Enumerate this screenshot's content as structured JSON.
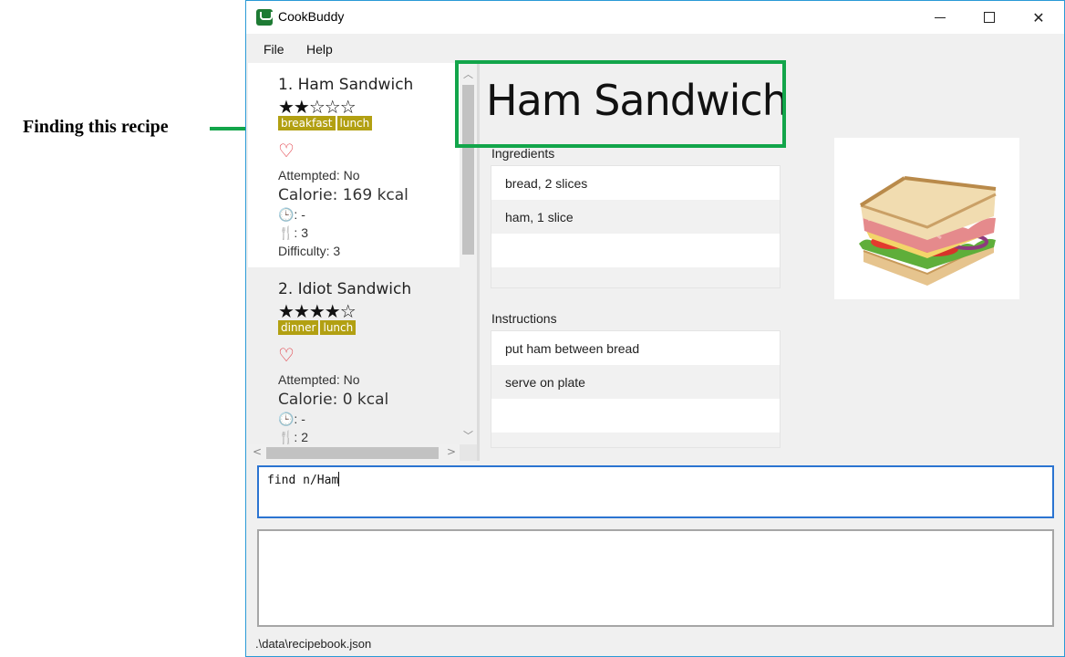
{
  "annotation": {
    "label": "Finding this recipe",
    "color": "#12a54a"
  },
  "window": {
    "title": "CookBuddy",
    "app_icon": "chef-hat-icon",
    "controls": {
      "minimize": "minimize-icon",
      "maximize": "maximize-icon",
      "close": "✕"
    }
  },
  "menu": {
    "items": [
      {
        "label": "File"
      },
      {
        "label": "Help"
      }
    ]
  },
  "recipe_list": {
    "cards": [
      {
        "title": "1.  Ham Sandwich",
        "stars": "★★☆☆☆",
        "rating": 2,
        "tags": [
          "breakfast",
          "lunch"
        ],
        "heart": "♡",
        "attempted": "Attempted: No",
        "calorie": "Calorie: 169 kcal",
        "time": "🕒: -",
        "servings": "🍴: 3",
        "difficulty": "Difficulty: 3"
      },
      {
        "title": "2.  Idiot Sandwich",
        "stars": "★★★★☆",
        "rating": 4,
        "tags": [
          "dinner",
          "lunch"
        ],
        "heart": "♡",
        "attempted": "Attempted: No",
        "calorie": "Calorie: 0 kcal",
        "time": "🕒: -",
        "servings": "🍴: 2"
      }
    ]
  },
  "detail": {
    "title": "Ham Sandwich",
    "ingredients_label": "Ingredients",
    "ingredients": [
      "bread, 2 slices",
      "ham, 1 slice",
      "",
      ""
    ],
    "instructions_label": "Instructions",
    "instructions": [
      "put ham between bread",
      "serve on plate",
      "",
      ""
    ]
  },
  "command": {
    "value": "find n/Ham"
  },
  "result": {
    "text": ""
  },
  "status": {
    "path": ".\\data\\recipebook.json"
  },
  "colors": {
    "tag": "#b2a012",
    "heart": "#e0303a",
    "command_border": "#2b74d1",
    "window_border": "#2a9ad6"
  }
}
